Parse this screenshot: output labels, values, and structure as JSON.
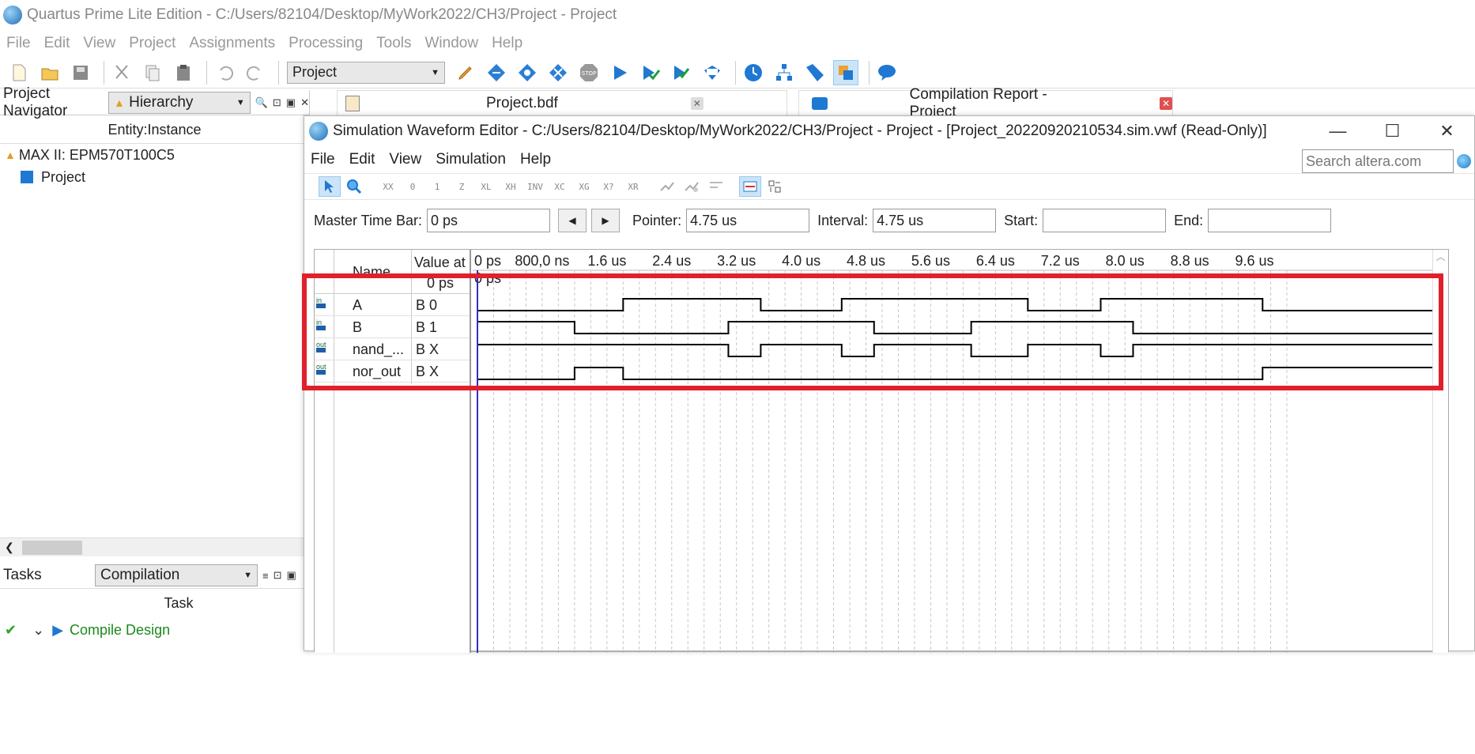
{
  "main_title": "Quartus Prime Lite Edition - C:/Users/82104/Desktop/MyWork2022/CH3/Project - Project",
  "main_menu": [
    "File",
    "Edit",
    "View",
    "Project",
    "Assignments",
    "Processing",
    "Tools",
    "Window",
    "Help"
  ],
  "toolbar": {
    "project_select": "Project"
  },
  "left": {
    "navigator_label": "Project Navigator",
    "navigator_dropdown": "Hierarchy",
    "entity_header": "Entity:Instance",
    "device": "MAX II: EPM570T100C5",
    "project": "Project",
    "tasks_label": "Tasks",
    "tasks_dropdown": "Compilation",
    "task_header": "Task",
    "task_row": "Compile Design"
  },
  "tabs": [
    {
      "label": "Project.bdf"
    },
    {
      "label": "Compilation Report - Project"
    }
  ],
  "sim": {
    "title": "Simulation Waveform Editor - C:/Users/82104/Desktop/MyWork2022/CH3/Project - Project - [Project_20220920210534.sim.vwf (Read-Only)]",
    "menu": [
      "File",
      "Edit",
      "View",
      "Simulation",
      "Help"
    ],
    "search_placeholder": "Search altera.com",
    "master_time_label": "Master Time Bar:",
    "master_time_value": "0 ps",
    "pointer_label": "Pointer:",
    "pointer_value": "4.75 us",
    "interval_label": "Interval:",
    "interval_value": "4.75 us",
    "start_label": "Start:",
    "start_value": "",
    "end_label": "End:",
    "end_value": "",
    "name_header": "Name",
    "value_header": "Value at",
    "value_sub": "0 ps",
    "cursor_label": "0 ps",
    "toolbar_glyphs": [
      "XX",
      "0",
      "1",
      "Z",
      "XL",
      "XH",
      "INV",
      "XC",
      "XG",
      "X?",
      "XR"
    ]
  },
  "signals": [
    {
      "dir": "in",
      "name": "A",
      "value": "B 0"
    },
    {
      "dir": "in",
      "name": "B",
      "value": "B 1"
    },
    {
      "dir": "out",
      "name": "nand_...",
      "value": "B X"
    },
    {
      "dir": "out",
      "name": "nor_out",
      "value": "B X"
    }
  ],
  "timeline": {
    "labels": [
      "0 ps",
      "800,0 ns",
      "1.6 us",
      "2.4 us",
      "3.2 us",
      "4.0 us",
      "4.8 us",
      "5.6 us",
      "6.4 us",
      "7.2 us",
      "8.0 us",
      "8.8 us",
      "9.6 us"
    ],
    "end_us": 10.0
  },
  "chart_data": {
    "type": "waveform",
    "time_unit": "us",
    "series": [
      {
        "name": "A",
        "initial": 0,
        "transitions_us": [
          1.8,
          3.5,
          4.5,
          6.8,
          7.7,
          9.7
        ]
      },
      {
        "name": "B",
        "initial": 1,
        "transitions_us": [
          1.2,
          3.1,
          4.9,
          6.1,
          8.1
        ]
      },
      {
        "name": "nand_...",
        "initial": 1,
        "transitions_us": [
          3.1,
          3.5,
          4.5,
          4.9,
          6.1,
          6.8,
          7.7,
          8.1
        ]
      },
      {
        "name": "nor_out",
        "initial": 0,
        "transitions_us": [
          1.2,
          1.8,
          9.7
        ]
      }
    ]
  },
  "colors": {
    "highlight": "#e0202a",
    "cursor": "#3030c0",
    "wave": "#000000"
  }
}
